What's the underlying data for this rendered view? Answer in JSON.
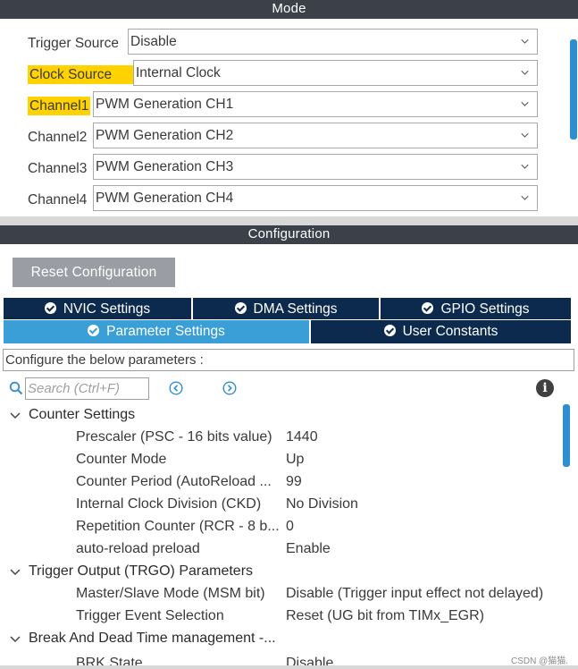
{
  "mode": {
    "header": "Mode",
    "rows": [
      {
        "label": "Trigger Source",
        "value": "Disable",
        "highlighted": false
      },
      {
        "label": "Clock Source",
        "value": "Internal Clock",
        "highlighted": true
      },
      {
        "label": "Channel1",
        "value": "PWM Generation CH1",
        "highlighted": true
      },
      {
        "label": "Channel2",
        "value": "PWM Generation CH2",
        "highlighted": false
      },
      {
        "label": "Channel3",
        "value": "PWM Generation CH3",
        "highlighted": false
      },
      {
        "label": "Channel4",
        "value": "PWM Generation CH4",
        "highlighted": false
      }
    ]
  },
  "configuration": {
    "header": "Configuration",
    "reset_button": "Reset Configuration",
    "tabs": {
      "nvic": "NVIC Settings",
      "dma": "DMA Settings",
      "gpio": "GPIO Settings",
      "parameter": "Parameter Settings",
      "user_constants": "User Constants"
    },
    "active_tab": "Parameter Settings",
    "description": "Configure the below parameters :",
    "search_placeholder": "Search (Ctrl+F)"
  },
  "params": {
    "groups": [
      {
        "label": "Counter Settings",
        "items": [
          {
            "name": "Prescaler (PSC - 16 bits value)",
            "value": "1440"
          },
          {
            "name": "Counter Mode",
            "value": "Up"
          },
          {
            "name": "Counter Period (AutoReload ...",
            "value": "99"
          },
          {
            "name": "Internal Clock Division (CKD)",
            "value": "No Division"
          },
          {
            "name": "Repetition Counter (RCR - 8 b...",
            "value": "0"
          },
          {
            "name": "auto-reload preload",
            "value": "Enable"
          }
        ]
      },
      {
        "label": "Trigger Output (TRGO) Parameters",
        "items": [
          {
            "name": "Master/Slave Mode (MSM bit)",
            "value": "Disable (Trigger input effect not delayed)"
          },
          {
            "name": "Trigger Event Selection",
            "value": "Reset (UG bit from TIMx_EGR)"
          }
        ]
      },
      {
        "label": "Break And Dead Time management -...",
        "items": [
          {
            "name": "BRK State",
            "value": "Disable"
          }
        ]
      }
    ]
  },
  "watermark": "CSDN @猫猫.",
  "colors": {
    "header_bg": "#3c4049",
    "highlight": "#ffd200",
    "tab_dark": "#0b2a4e",
    "tab_active": "#3a9fd7",
    "scrollbar": "#2e8fd0",
    "reset_button": "#9a9da3"
  }
}
